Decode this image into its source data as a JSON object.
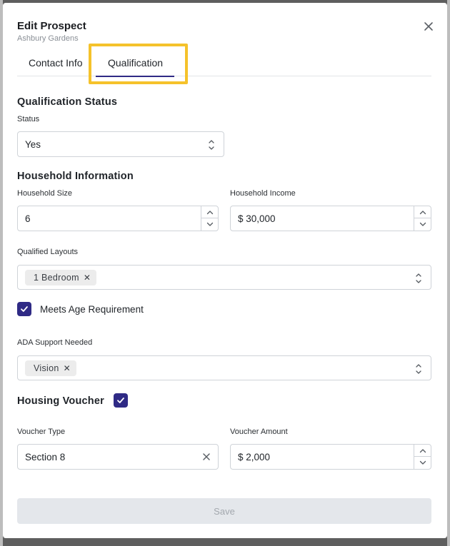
{
  "modal": {
    "title": "Edit Prospect",
    "subtitle": "Ashbury Gardens",
    "close_icon": "close-icon"
  },
  "tabs": [
    {
      "label": "Contact Info",
      "active": false
    },
    {
      "label": "Qualification",
      "active": true
    }
  ],
  "qualification_status": {
    "section_title": "Qualification Status",
    "status_label": "Status",
    "status_value": "Yes"
  },
  "household": {
    "section_title": "Household Information",
    "size_label": "Household Size",
    "size_value": "6",
    "income_label": "Household Income",
    "income_value": "$ 30,000",
    "layouts_label": "Qualified Layouts",
    "layouts_chips": [
      "1 Bedroom"
    ],
    "age_requirement_label": "Meets Age Requirement",
    "age_requirement_checked": true,
    "ada_label": "ADA Support Needed",
    "ada_chips": [
      "Vision"
    ]
  },
  "voucher": {
    "section_title": "Housing Voucher",
    "checked": true,
    "type_label": "Voucher Type",
    "type_value": "Section 8",
    "amount_label": "Voucher Amount",
    "amount_value": "$ 2,000"
  },
  "footer": {
    "save_label": "Save"
  },
  "colors": {
    "accent": "#2f2a85",
    "highlight": "#f5c22b",
    "disabled_bg": "#e4e7eb"
  }
}
